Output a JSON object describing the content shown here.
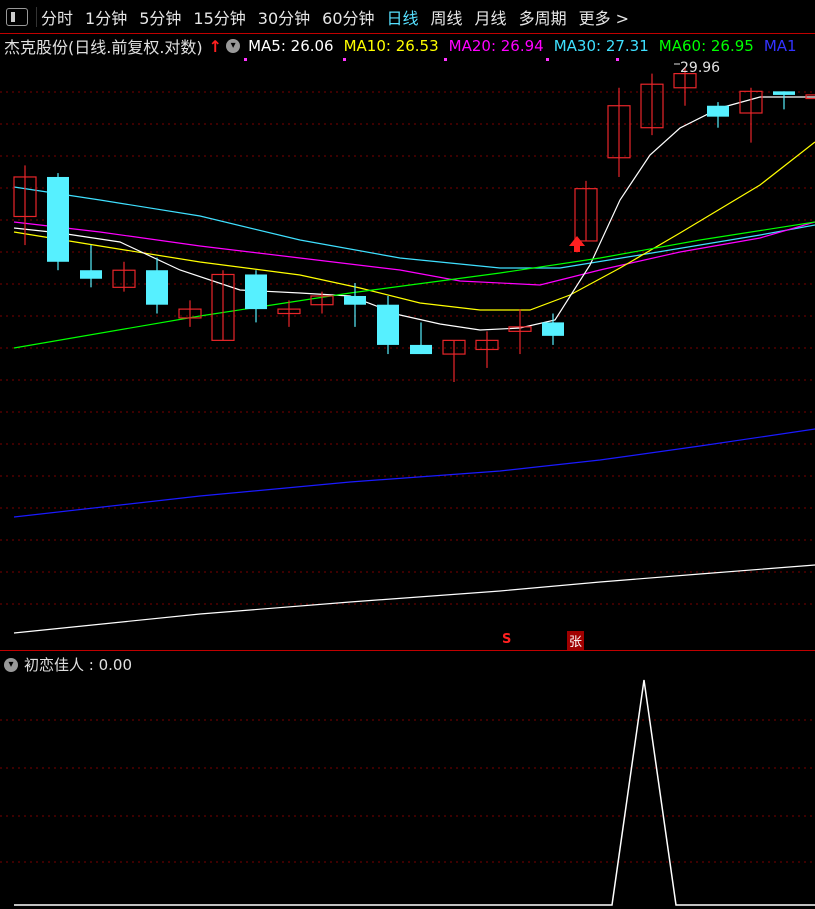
{
  "toolbar": {
    "tabs": [
      {
        "label": "分时",
        "active": false
      },
      {
        "label": "1分钟",
        "active": false
      },
      {
        "label": "5分钟",
        "active": false
      },
      {
        "label": "15分钟",
        "active": false
      },
      {
        "label": "30分钟",
        "active": false
      },
      {
        "label": "60分钟",
        "active": false
      },
      {
        "label": "日线",
        "active": true
      },
      {
        "label": "周线",
        "active": false
      },
      {
        "label": "月线",
        "active": false
      },
      {
        "label": "多周期",
        "active": false
      },
      {
        "label": "更多 >",
        "active": false
      }
    ]
  },
  "info": {
    "stock_title": "杰克股份(日线.前复权.对数)",
    "ma5": "MA5: 26.06",
    "ma10": "MA10: 26.53",
    "ma20": "MA20: 26.94",
    "ma30": "MA30: 27.31",
    "ma60": "MA60: 26.95",
    "ma_extra": "MA1"
  },
  "colors": {
    "up": "#e8262a",
    "down": "#56f0ff",
    "ma5": "#ffffff",
    "ma10": "#ffff00",
    "ma20": "#ff00ff",
    "ma30": "#3fe0ff",
    "ma60": "#00ff00",
    "ma120": "#1a1aff",
    "ma250": "#ffffff"
  },
  "indicator": {
    "label": "初恋佳人 : 0.00"
  },
  "markers": {
    "s_label": "S",
    "zhang_label": "张"
  },
  "high_label": "29.96",
  "chart_data": {
    "type": "candlestick",
    "candles": [
      {
        "o": 26.0,
        "h": 27.3,
        "l": 25.3,
        "c": 27.0
      },
      {
        "o": 27.0,
        "h": 27.1,
        "l": 24.7,
        "c": 24.9
      },
      {
        "o": 24.7,
        "h": 25.3,
        "l": 24.3,
        "c": 24.5
      },
      {
        "o": 24.3,
        "h": 24.9,
        "l": 24.2,
        "c": 24.7
      },
      {
        "o": 24.7,
        "h": 25.0,
        "l": 23.7,
        "c": 23.9
      },
      {
        "o": 23.6,
        "h": 24.0,
        "l": 23.4,
        "c": 23.8
      },
      {
        "o": 23.1,
        "h": 24.7,
        "l": 23.1,
        "c": 24.6
      },
      {
        "o": 24.6,
        "h": 24.7,
        "l": 23.5,
        "c": 23.8
      },
      {
        "o": 23.7,
        "h": 24.0,
        "l": 23.4,
        "c": 23.8
      },
      {
        "o": 23.9,
        "h": 24.2,
        "l": 23.7,
        "c": 24.1
      },
      {
        "o": 24.1,
        "h": 24.4,
        "l": 23.4,
        "c": 23.9
      },
      {
        "o": 23.9,
        "h": 24.1,
        "l": 22.8,
        "c": 23.0
      },
      {
        "o": 23.0,
        "h": 23.5,
        "l": 22.8,
        "c": 22.8
      },
      {
        "o": 22.8,
        "h": 23.1,
        "l": 22.2,
        "c": 23.1
      },
      {
        "o": 22.9,
        "h": 23.3,
        "l": 22.5,
        "c": 23.1
      },
      {
        "o": 23.3,
        "h": 23.8,
        "l": 22.8,
        "c": 23.4
      },
      {
        "o": 23.5,
        "h": 23.7,
        "l": 23.0,
        "c": 23.2
      },
      {
        "o": 25.4,
        "h": 26.9,
        "l": 25.4,
        "c": 26.7
      },
      {
        "o": 27.5,
        "h": 29.4,
        "l": 27.0,
        "c": 28.9
      },
      {
        "o": 28.3,
        "h": 29.8,
        "l": 28.1,
        "c": 29.5
      },
      {
        "o": 29.4,
        "h": 29.96,
        "l": 28.9,
        "c": 29.8
      },
      {
        "o": 28.9,
        "h": 29.0,
        "l": 28.3,
        "c": 28.6
      },
      {
        "o": 28.7,
        "h": 29.4,
        "l": 27.9,
        "c": 29.3
      },
      {
        "o": 29.3,
        "h": 29.3,
        "l": 28.8,
        "c": 29.2
      },
      {
        "o": 29.1,
        "h": 29.3,
        "l": 29.0,
        "c": 29.2
      }
    ],
    "indicator": {
      "name": "初恋佳人",
      "value": 0.0
    }
  }
}
